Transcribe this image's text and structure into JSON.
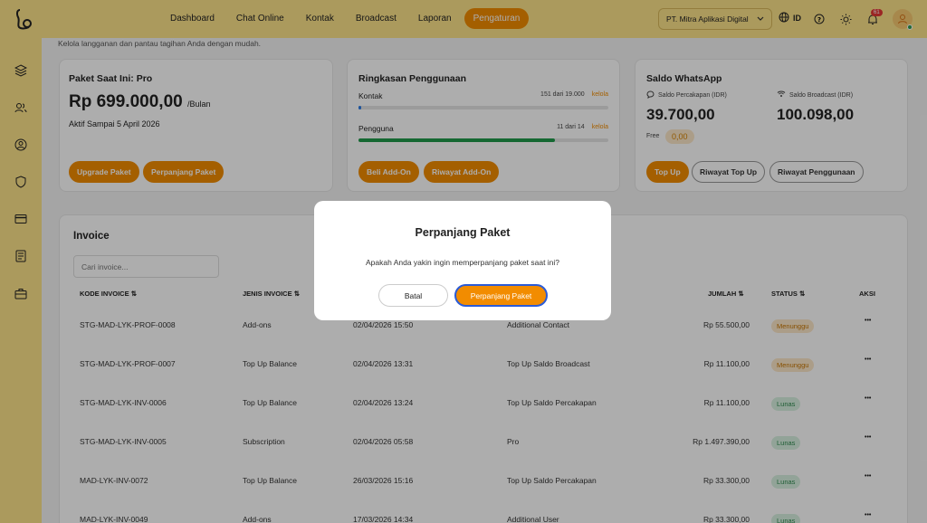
{
  "nav": {
    "items": [
      "Dashboard",
      "Chat Online",
      "Kontak",
      "Broadcast",
      "Laporan",
      "Pengaturan"
    ],
    "active": "Pengaturan"
  },
  "org": {
    "name": "PT. Mitra Aplikasi Digital"
  },
  "lang": "ID",
  "notifications": "61",
  "page": {
    "subtitle": "Kelola langganan dan pantau tagihan Anda dengan mudah."
  },
  "plan": {
    "title": "Paket Saat Ini: Pro",
    "price": "Rp 699.000,00",
    "unit": "/Bulan",
    "active_until": "Aktif Sampai 5 April 2026",
    "upgrade_label": "Upgrade Paket",
    "extend_label": "Perpanjang Paket"
  },
  "usage": {
    "title": "Ringkasan Penggunaan",
    "contacts": {
      "label": "Kontak",
      "count": "151 dari 19.000",
      "manage": "kelola",
      "fraction": 0.008
    },
    "users": {
      "label": "Pengguna",
      "count": "11 dari 14",
      "manage": "kelola",
      "fraction": 0.786
    },
    "buy_addon_label": "Beli Add-On",
    "addon_history_label": "Riwayat Add-On"
  },
  "whatsapp": {
    "title": "Saldo WhatsApp",
    "conv_label": "Saldo Percakapan (IDR)",
    "conv_value": "39.700,00",
    "broadcast_label": "Saldo Broadcast (IDR)",
    "broadcast_value": "100.098,00",
    "free_label": "Free",
    "free_value": "0,00",
    "topup_label": "Top Up",
    "topup_history_label": "Riwayat Top Up",
    "usage_history_label": "Riwayat Penggunaan"
  },
  "invoice": {
    "title": "Invoice",
    "search_placeholder": "Cari invoice...",
    "headers": {
      "code": "KODE INVOICE",
      "type": "JENIS INVOICE",
      "amount": "JUMLAH",
      "status": "STATUS",
      "action": "AKSI"
    },
    "rows": [
      {
        "code": "STG-MAD-LYK-PROF-0008",
        "type": "Add-ons",
        "date": "02/04/2026 15:50",
        "desc": "Additional Contact",
        "amount": "Rp 55.500,00",
        "status": "Menunggu"
      },
      {
        "code": "STG-MAD-LYK-PROF-0007",
        "type": "Top Up Balance",
        "date": "02/04/2026 13:31",
        "desc": "Top Up Saldo Broadcast",
        "amount": "Rp 11.100,00",
        "status": "Menunggu"
      },
      {
        "code": "STG-MAD-LYK-INV-0006",
        "type": "Top Up Balance",
        "date": "02/04/2026 13:24",
        "desc": "Top Up Saldo Percakapan",
        "amount": "Rp 11.100,00",
        "status": "Lunas"
      },
      {
        "code": "STG-MAD-LYK-INV-0005",
        "type": "Subscription",
        "date": "02/04/2026 05:58",
        "desc": "Pro",
        "amount": "Rp 1.497.390,00",
        "status": "Lunas"
      },
      {
        "code": "MAD-LYK-INV-0072",
        "type": "Top Up Balance",
        "date": "26/03/2026 15:16",
        "desc": "Top Up Saldo Percakapan",
        "amount": "Rp 33.300,00",
        "status": "Lunas"
      },
      {
        "code": "MAD-LYK-INV-0049",
        "type": "Add-ons",
        "date": "17/03/2026 14:34",
        "desc": "Additional User",
        "amount": "Rp 33.300,00",
        "status": "Lunas"
      }
    ]
  },
  "modal": {
    "title": "Perpanjang Paket",
    "message": "Apakah Anda yakin ingin memperpanjang paket saat ini?",
    "cancel_label": "Batal",
    "confirm_label": "Perpanjang Paket"
  },
  "colors": {
    "accent": "#f28c00",
    "topbar": "#fde38a",
    "progress_green": "#1f9a4a",
    "progress_blue": "#2c7be5"
  }
}
